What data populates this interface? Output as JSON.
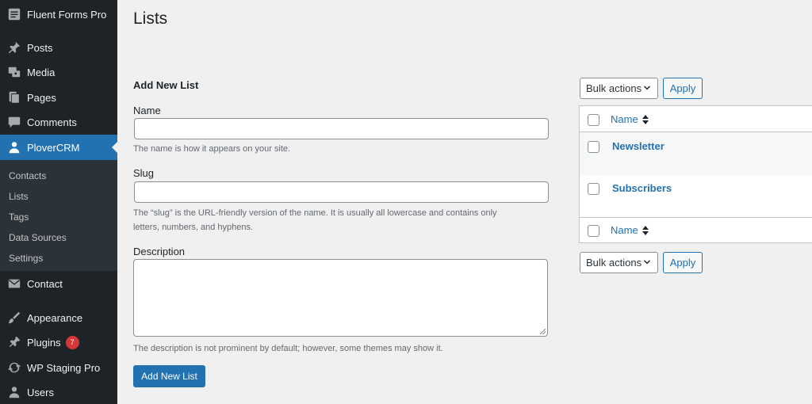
{
  "sidebar": {
    "top_item": "Fluent Forms Pro",
    "items": [
      {
        "label": "Posts",
        "icon": "pin-icon"
      },
      {
        "label": "Media",
        "icon": "media-icon"
      },
      {
        "label": "Pages",
        "icon": "pages-icon"
      },
      {
        "label": "Comments",
        "icon": "comments-icon"
      },
      {
        "label": "PloverCRM",
        "icon": "user-icon"
      }
    ],
    "submenu": [
      "Contacts",
      "Lists",
      "Tags",
      "Data Sources",
      "Settings"
    ],
    "items_lower": [
      {
        "label": "Contact",
        "icon": "envelope-icon"
      },
      {
        "label": "Appearance",
        "icon": "brush-icon"
      },
      {
        "label": "Plugins",
        "icon": "plugin-icon",
        "badge": "7"
      },
      {
        "label": "WP Staging Pro",
        "icon": "sync-icon"
      },
      {
        "label": "Users",
        "icon": "users-icon"
      }
    ]
  },
  "page": {
    "title": "Lists"
  },
  "form": {
    "heading": "Add New List",
    "name_label": "Name",
    "name_value": "",
    "name_help": "The name is how it appears on your site.",
    "slug_label": "Slug",
    "slug_value": "",
    "slug_help_1": "The “slug” is the URL-friendly version of the name. It is usually all lowercase and contains only",
    "slug_help_2": "letters, numbers, and hyphens.",
    "description_label": "Description",
    "description_value": "",
    "description_help": "The description is not prominent by default; however, some themes may show it.",
    "submit_label": "Add New List"
  },
  "table": {
    "bulk_actions": "Bulk actions",
    "apply": "Apply",
    "column_name": "Name",
    "rows": [
      "Newsletter",
      "Subscribers"
    ]
  },
  "colors": {
    "sidebar_bg": "#1d2327",
    "accent": "#2271b1",
    "badge": "#d63638"
  }
}
